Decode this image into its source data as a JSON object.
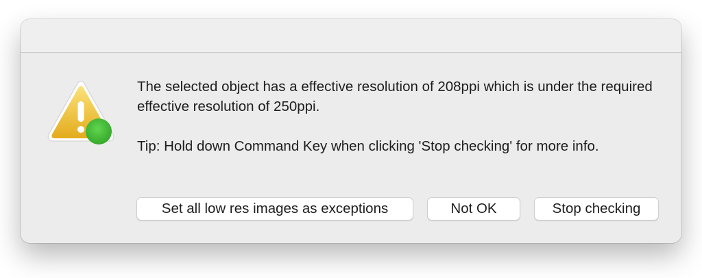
{
  "alert": {
    "icon": "warning-triangle-icon",
    "badge_icon": "green-status-dot-icon",
    "message_line": "The selected object has a effective resolution of 208ppi which is under the required effective resolution of 250ppi.",
    "tip_line": "Tip: Hold down Command Key when clicking 'Stop checking' for more info."
  },
  "buttons": {
    "exceptions_label": "Set all low res images as exceptions",
    "not_ok_label": "Not OK",
    "stop_label": "Stop checking"
  },
  "colors": {
    "warning_yellow": "#f2c53d",
    "badge_green": "#49c23a"
  }
}
